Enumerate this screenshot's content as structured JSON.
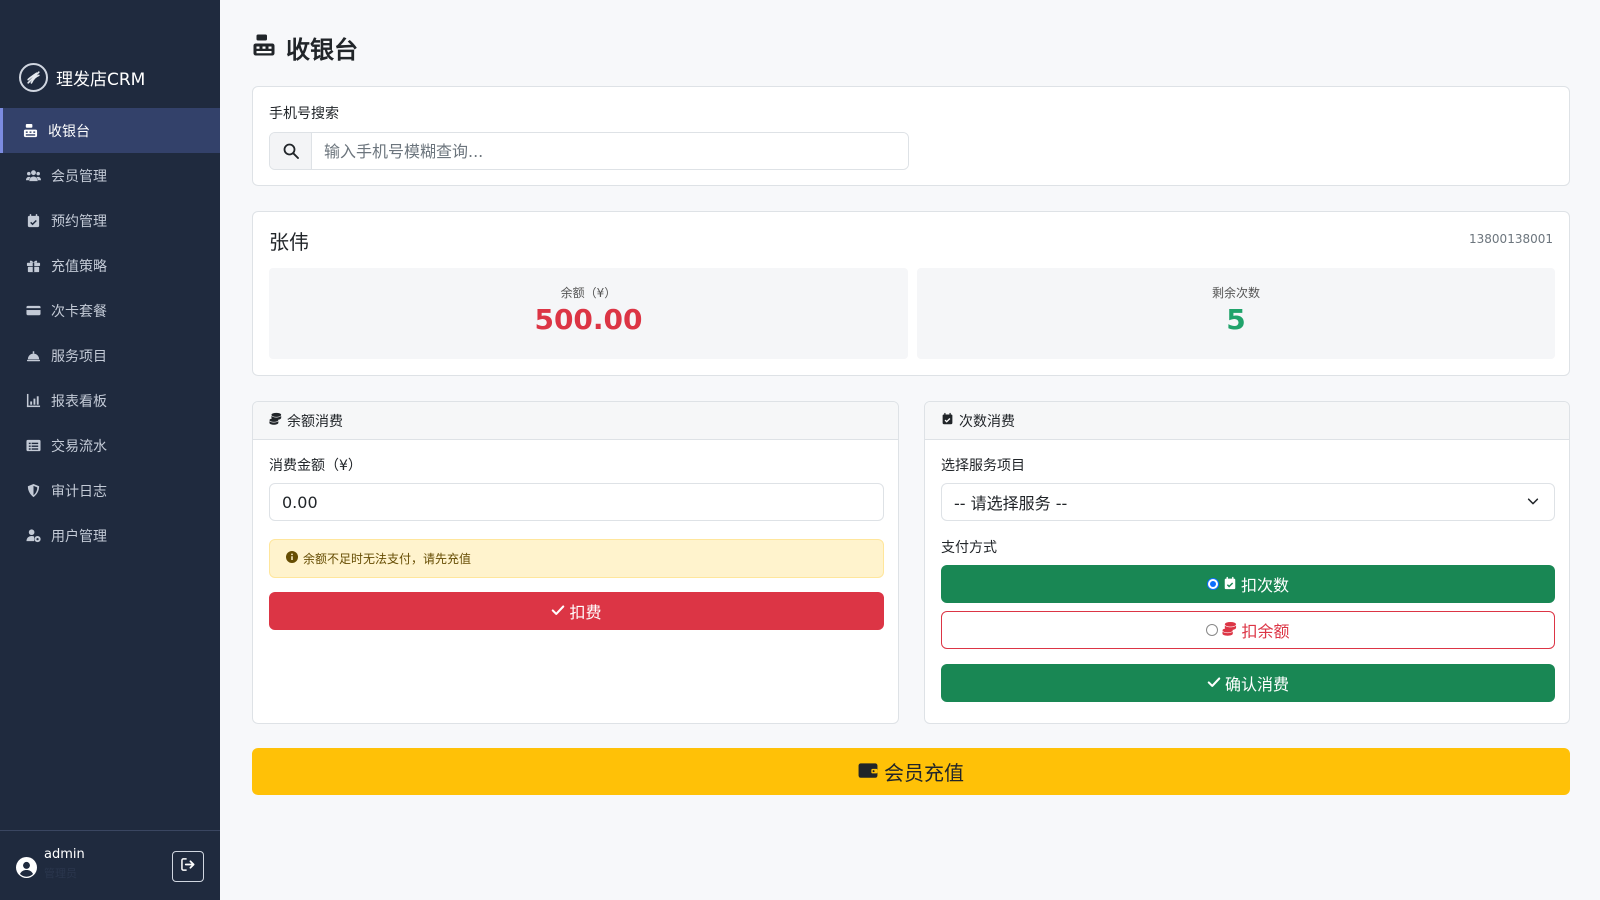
{
  "app": {
    "name": "理发店CRM"
  },
  "sidebar": {
    "items": [
      {
        "label": "收银台",
        "icon": "cash-register-icon",
        "active": true
      },
      {
        "label": "会员管理",
        "icon": "users-icon"
      },
      {
        "label": "预约管理",
        "icon": "calendar-check-icon"
      },
      {
        "label": "充值策略",
        "icon": "gift-icon"
      },
      {
        "label": "次卡套餐",
        "icon": "card-icon"
      },
      {
        "label": "服务项目",
        "icon": "bell-service-icon"
      },
      {
        "label": "报表看板",
        "icon": "chart-icon"
      },
      {
        "label": "交易流水",
        "icon": "list-icon"
      },
      {
        "label": "审计日志",
        "icon": "shield-icon"
      },
      {
        "label": "用户管理",
        "icon": "user-cog-icon"
      }
    ],
    "user": {
      "name": "admin",
      "role": "管理员"
    }
  },
  "page": {
    "title": "收银台"
  },
  "search": {
    "label": "手机号搜索",
    "placeholder": "输入手机号模糊查询..."
  },
  "member": {
    "name": "张伟",
    "phone": "13800138001",
    "balance_label": "余额（¥）",
    "balance_value": "500.00",
    "times_label": "剩余次数",
    "times_value": "5"
  },
  "balance_pay": {
    "title": "余额消费",
    "amount_label": "消费金额（¥）",
    "amount_value": "0.00",
    "warning": "余额不足时无法支付，请先充值",
    "submit_label": "扣费"
  },
  "times_pay": {
    "title": "次数消费",
    "service_label": "选择服务项目",
    "service_value": "-- 请选择服务 --",
    "method_label": "支付方式",
    "method_times": "扣次数",
    "method_balance": "扣余额",
    "confirm_label": "确认消费"
  },
  "recharge": {
    "label": "会员充值"
  },
  "colors": {
    "sidebar_bg": "#1f2a3e",
    "danger": "#dc3545",
    "success": "#198754",
    "warning": "#ffc107",
    "times_value": "#20a36b"
  }
}
